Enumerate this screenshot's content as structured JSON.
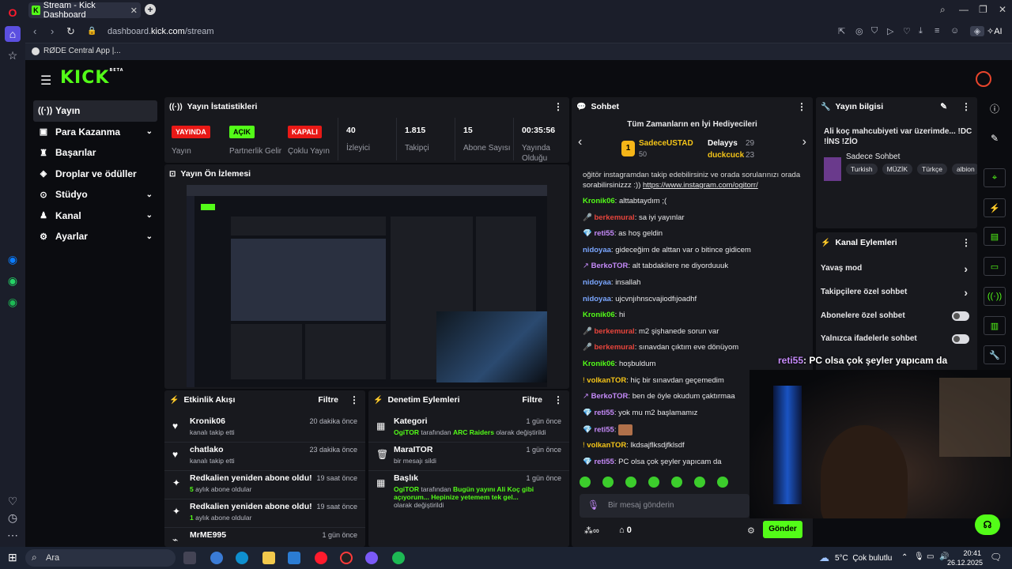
{
  "browser": {
    "tab_title": "Stream - Kick Dashboard",
    "url_prefix": "dashboard.",
    "url_domain": "kick.com",
    "url_path": "/stream",
    "bookmark": "RØDE Central App |...",
    "ai_label": "AI"
  },
  "nav": {
    "items": [
      {
        "label": "Yayın"
      },
      {
        "label": "Para Kazanma"
      },
      {
        "label": "Başarılar"
      },
      {
        "label": "Droplar ve ödüller"
      },
      {
        "label": "Stüdyo"
      },
      {
        "label": "Kanal"
      },
      {
        "label": "Ayarlar"
      }
    ]
  },
  "stats": {
    "title": "Yayın İstatistikleri",
    "items": [
      {
        "badge": "YAYINDA",
        "label": "Yayın"
      },
      {
        "badge": "AÇIK",
        "label": "Partnerlik Gelir"
      },
      {
        "badge": "KAPALI",
        "label": "Çoklu Yayın"
      },
      {
        "value": "40",
        "label": "İzleyici"
      },
      {
        "value": "1.815",
        "label": "Takipçi"
      },
      {
        "value": "15",
        "label": "Abone Sayısı"
      },
      {
        "value": "00:35:56",
        "label": "Yayında Olduğu"
      }
    ]
  },
  "preview": {
    "title": "Yayın Ön İzlemesi"
  },
  "activity": {
    "title": "Etkinlik Akışı",
    "filter": "Filtre",
    "items": [
      {
        "title": "Kronik06",
        "sub": "kanalı takip etti",
        "time": "20 dakika önce"
      },
      {
        "title": "chatlako",
        "sub": "kanalı takip etti",
        "time": "23 dakika önce"
      },
      {
        "title": "Redkalien yeniden abone oldu!",
        "num": "5",
        "sub": " aylık abone oldular",
        "time": "19 saat önce"
      },
      {
        "title": "Redkalien yeniden abone oldu!",
        "num": "1",
        "sub": " aylık abone oldular",
        "time": "19 saat önce"
      },
      {
        "title": "MrME995",
        "sub": "",
        "time": "1 gün önce"
      }
    ]
  },
  "moderation": {
    "title": "Denetim Eylemleri",
    "filter": "Filtre",
    "items": [
      {
        "title": "Kategori",
        "actor": "OgiTOR",
        "mid": " tarafından ",
        "target": "ARC Raiders",
        "tail": " olarak değiştirildi",
        "time": "1 gün önce"
      },
      {
        "title": "MaraITOR",
        "sub": "bir mesajı sildi",
        "time": "1 gün önce"
      },
      {
        "title": "Başlık",
        "actor": "OgiTOR",
        "mid": " tarafından ",
        "target": "Bugün yayını Ali Koç gibi açıyorum... Hepinize yetemem tek gel...",
        "tail": " olarak değiştirildi",
        "time": "1 gün önce"
      }
    ]
  },
  "chat": {
    "title": "Sohbet",
    "top_title": "Tüm Zamanların en İyi Hediyecileri",
    "top1_name": "SadeceUSTAD",
    "top1_value": "50",
    "top2_name": "Delayys",
    "top2_value": "29",
    "top3_name": "duckcuck",
    "top3_value": "23",
    "partial_line1": "oğitör instagramdan takip edebilirsiniz ve orada sorularınızı orada",
    "partial_line2": "sorabilirsinizzz :)) ",
    "partial_link": "https://www.instagram.com/ogitorr/",
    "messages": [
      {
        "user": "Kronik06",
        "color": "#53fc18",
        "text": "alttabtaydım ;("
      },
      {
        "user": "berkemural",
        "color": "#e8453c",
        "text": "sa iyi yayınlar"
      },
      {
        "user": "reti55",
        "color": "#c58af9",
        "text": "as hoş geldin"
      },
      {
        "user": "nidoyaa",
        "color": "#7aa6ff",
        "text": "gideceğim de alttan var o bitince gidicem"
      },
      {
        "user": "BerkoTOR",
        "color": "#c58af9",
        "text": "alt tabdakilere ne diyorduuuk"
      },
      {
        "user": "nidoyaa",
        "color": "#7aa6ff",
        "text": "insallah"
      },
      {
        "user": "nidoyaa",
        "color": "#7aa6ff",
        "text": "ujcvnjıhnscvajiodfıjoadhf"
      },
      {
        "user": "Kronik06",
        "color": "#53fc18",
        "text": "hi"
      },
      {
        "user": "berkemural",
        "color": "#e8453c",
        "text": "m2 şişhanede sorun var"
      },
      {
        "user": "berkemural",
        "color": "#e8453c",
        "text": "sınavdan çıktım eve dönüyom"
      },
      {
        "user": "Kronik06",
        "color": "#53fc18",
        "text": "hoşbuldum"
      },
      {
        "user": "volkanTOR",
        "color": "#f5c518",
        "text": "hiç bir sınavdan geçemedim"
      },
      {
        "user": "BerkoTOR",
        "color": "#c58af9",
        "text": "ben de öyle okudum çaktırmaa"
      },
      {
        "user": "reti55",
        "color": "#c58af9",
        "text": "yok mu m2 başlamamız"
      },
      {
        "user": "reti55",
        "color": "#c58af9",
        "text": ""
      },
      {
        "user": "volkanTOR",
        "color": "#f5c518",
        "text": "lkdsajflksdjfklsdf"
      },
      {
        "user": "reti55",
        "color": "#c58af9",
        "text": "PC olsa çok şeyler yapıcam da"
      }
    ],
    "input_placeholder": "Bir mesaj gönderin",
    "send": "Gönder",
    "infinity": "∞",
    "count": "0"
  },
  "streaminfo": {
    "title": "Yayın bilgisi",
    "stream_title": "Ali koç mahcubiyeti var üzerimde... !DC !İNS !ZİO",
    "category": "Sadece Sohbet",
    "tags": [
      "Turkish",
      "MÜZİK",
      "Türkçe",
      "albion"
    ]
  },
  "channel_actions": {
    "title": "Kanal Eylemleri",
    "items": [
      {
        "label": "Yavaş mod",
        "kind": "chevron"
      },
      {
        "label": "Takipçilere özel sohbet",
        "kind": "chevron"
      },
      {
        "label": "Abonelere özel sohbet",
        "kind": "toggle"
      },
      {
        "label": "Yalnızca ifadelerle sohbet",
        "kind": "toggle"
      }
    ]
  },
  "overlay": {
    "user": "reti55",
    "text": "PC olsa çok şeyler yapıcam da"
  },
  "taskbar": {
    "search": "Ara",
    "weather": "5°C  Çok bulutlu",
    "time": "20:41",
    "date": "26.12.2025"
  },
  "colors": {
    "accent": "#53fc18",
    "live": "#e91916",
    "panel": "#18191e"
  }
}
